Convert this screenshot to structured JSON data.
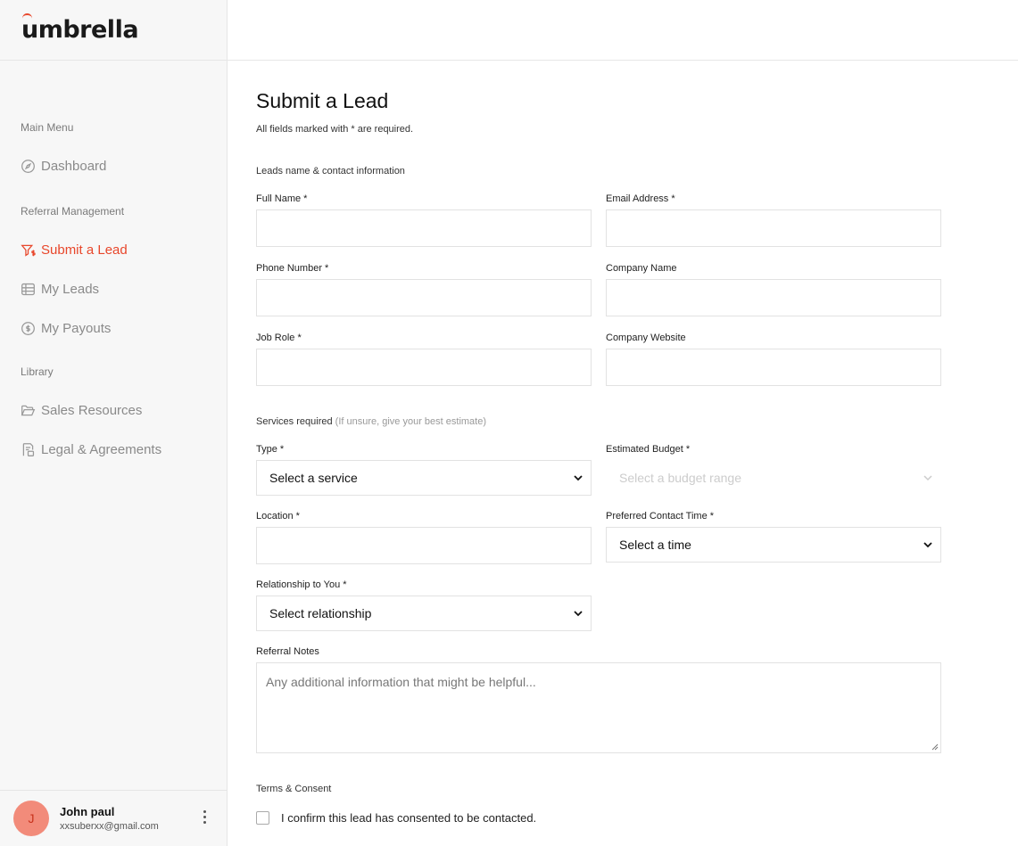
{
  "brand": {
    "logo_text": "umbrella",
    "accent_color": "#e8472b"
  },
  "sidebar": {
    "sections": [
      {
        "title": "Main Menu",
        "items": [
          {
            "label": "Dashboard",
            "icon": "compass-icon",
            "active": false
          }
        ]
      },
      {
        "title": "Referral Management",
        "items": [
          {
            "label": "Submit a Lead",
            "icon": "funnel-dollar-icon",
            "active": true
          },
          {
            "label": "My Leads",
            "icon": "table-list-icon",
            "active": false
          },
          {
            "label": "My Payouts",
            "icon": "dollar-circle-icon",
            "active": false
          }
        ]
      },
      {
        "title": "Library",
        "items": [
          {
            "label": "Sales Resources",
            "icon": "folder-open-icon",
            "active": false
          },
          {
            "label": "Legal & Agreements",
            "icon": "document-icon",
            "active": false
          }
        ]
      }
    ]
  },
  "user": {
    "initial": "J",
    "name": "John paul",
    "email": "xxsuberxx@gmail.com"
  },
  "form": {
    "title": "Submit a Lead",
    "subtitle": "All fields marked with * are required.",
    "contact_section": "Leads name & contact information",
    "full_name_label": "Full Name *",
    "email_label": "Email Address *",
    "phone_label": "Phone Number *",
    "company_name_label": "Company Name",
    "job_role_label": "Job Role *",
    "company_website_label": "Company Website",
    "services_section": "Services required",
    "services_hint": "(If unsure, give your best estimate)",
    "type_label": "Type *",
    "type_value": "Select a service",
    "budget_label": "Estimated Budget *",
    "budget_value": "Select a budget range",
    "location_label": "Location *",
    "contact_time_label": "Preferred Contact Time *",
    "contact_time_value": "Select a time",
    "relationship_label": "Relationship to You *",
    "relationship_value": "Select relationship",
    "notes_label": "Referral Notes",
    "notes_placeholder": "Any additional information that might be helpful...",
    "terms_section": "Terms & Consent",
    "consent_label": "I confirm this lead has consented to be contacted."
  }
}
